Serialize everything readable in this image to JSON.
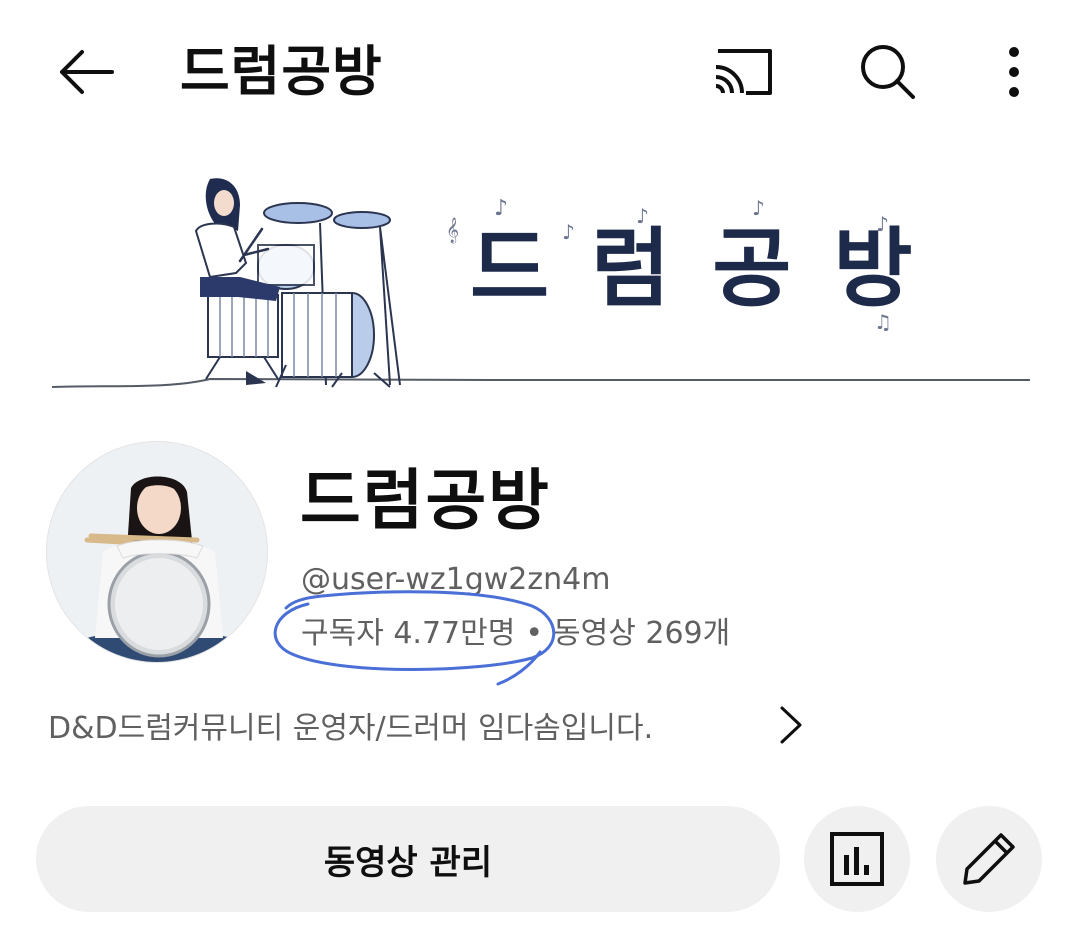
{
  "appbar": {
    "title": "드럼공방",
    "icons": [
      "back-arrow-icon",
      "cast-icon",
      "search-icon",
      "more-vert-icon"
    ]
  },
  "banner": {
    "title": "드럼공방"
  },
  "channel": {
    "name": "드럼공방",
    "handle": "@user-wz1gw2zn4m",
    "subscribers": "구독자 4.77만명",
    "separator": "•",
    "videos": "동영상 269개",
    "description": "D&D드럼커뮤니티 운영자/드러머 임다솜입니다."
  },
  "actions": {
    "manage_videos_label": "동영상 관리",
    "icons": [
      "analytics-icon",
      "edit-pencil-icon"
    ]
  },
  "colors": {
    "text_primary": "#0f0f0f",
    "text_secondary": "#606060",
    "button_bg": "#f0f0f0",
    "annotation_blue": "#4a6fd6",
    "banner_navy": "#1e2a4a"
  }
}
